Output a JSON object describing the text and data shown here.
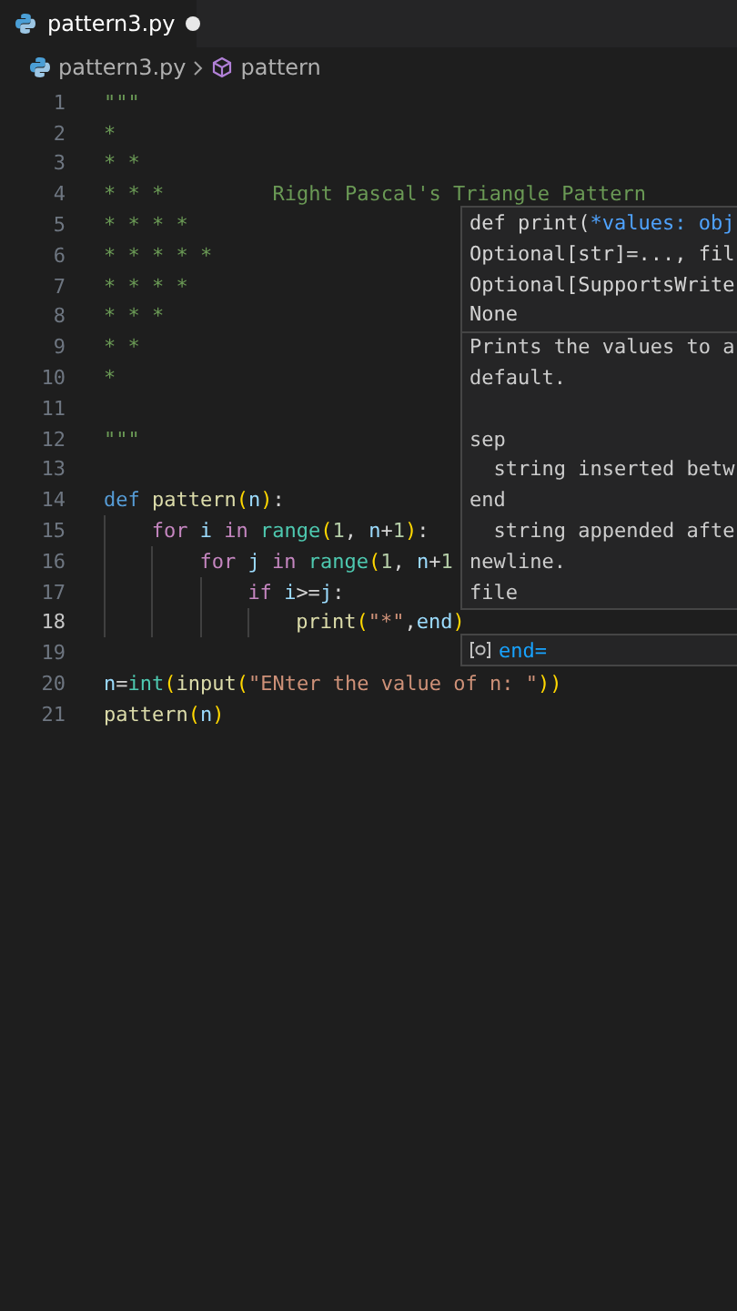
{
  "tab": {
    "title": "pattern3.py",
    "modified": true
  },
  "breadcrumb": {
    "file": "pattern3.py",
    "symbol": "pattern"
  },
  "lines": [
    {
      "number": "1",
      "current": false,
      "tokens": [
        {
          "kind": "doc",
          "text": "\"\"\""
        }
      ]
    },
    {
      "number": "2",
      "current": false,
      "tokens": [
        {
          "kind": "doc",
          "text": "*"
        }
      ]
    },
    {
      "number": "3",
      "current": false,
      "tokens": [
        {
          "kind": "doc",
          "text": "* *"
        }
      ]
    },
    {
      "number": "4",
      "current": false,
      "tokens": [
        {
          "kind": "doc",
          "text": "* * *         Right Pascal's Triangle Pattern"
        }
      ]
    },
    {
      "number": "5",
      "current": false,
      "tokens": [
        {
          "kind": "doc",
          "text": "* * * *"
        }
      ]
    },
    {
      "number": "6",
      "current": false,
      "tokens": [
        {
          "kind": "doc",
          "text": "* * * * *"
        }
      ]
    },
    {
      "number": "7",
      "current": false,
      "tokens": [
        {
          "kind": "doc",
          "text": "* * * *"
        }
      ]
    },
    {
      "number": "8",
      "current": false,
      "tokens": [
        {
          "kind": "doc",
          "text": "* * *"
        }
      ]
    },
    {
      "number": "9",
      "current": false,
      "tokens": [
        {
          "kind": "doc",
          "text": "* *"
        }
      ]
    },
    {
      "number": "10",
      "current": false,
      "tokens": [
        {
          "kind": "doc",
          "text": "*"
        }
      ]
    },
    {
      "number": "11",
      "current": false
    },
    {
      "number": "12",
      "current": false,
      "tokens": [
        {
          "kind": "doc",
          "text": "\"\"\""
        }
      ]
    },
    {
      "number": "13",
      "current": false
    },
    {
      "number": "14",
      "current": false,
      "tokens": [
        {
          "kind": "def",
          "text": "def "
        },
        {
          "kind": "fn",
          "text": "pattern"
        },
        {
          "kind": "bracket",
          "text": "("
        },
        {
          "kind": "var",
          "text": "n"
        },
        {
          "kind": "bracket",
          "text": ")"
        },
        {
          "kind": "punc",
          "text": ":"
        }
      ],
      "children": [
        {
          "number": "15",
          "current": false,
          "tokens": [
            {
              "kind": "kw",
              "text": "for "
            },
            {
              "kind": "var",
              "text": "i "
            },
            {
              "kind": "kw",
              "text": "in "
            },
            {
              "kind": "cls",
              "text": "range"
            },
            {
              "kind": "bracket",
              "text": "("
            },
            {
              "kind": "num",
              "text": "1"
            },
            {
              "kind": "punc",
              "text": ", "
            },
            {
              "kind": "var",
              "text": "n"
            },
            {
              "kind": "punc",
              "text": "+"
            },
            {
              "kind": "num",
              "text": "1"
            },
            {
              "kind": "bracket",
              "text": ")"
            },
            {
              "kind": "punc",
              "text": ":"
            }
          ],
          "children": [
            {
              "number": "16",
              "current": false,
              "tokens": [
                {
                  "kind": "kw",
                  "text": "for "
                },
                {
                  "kind": "var",
                  "text": "j "
                },
                {
                  "kind": "kw",
                  "text": "in "
                },
                {
                  "kind": "cls",
                  "text": "range"
                },
                {
                  "kind": "bracket",
                  "text": "("
                },
                {
                  "kind": "num",
                  "text": "1"
                },
                {
                  "kind": "punc",
                  "text": ", "
                },
                {
                  "kind": "var",
                  "text": "n"
                },
                {
                  "kind": "punc",
                  "text": "+"
                },
                {
                  "kind": "num",
                  "text": "1"
                }
              ],
              "children": [
                {
                  "number": "17",
                  "current": false,
                  "tokens": [
                    {
                      "kind": "kw",
                      "text": "if "
                    },
                    {
                      "kind": "var",
                      "text": "i"
                    },
                    {
                      "kind": "punc",
                      "text": ">="
                    },
                    {
                      "kind": "var",
                      "text": "j"
                    },
                    {
                      "kind": "punc",
                      "text": ":"
                    }
                  ],
                  "children": [
                    {
                      "number": "18",
                      "current": true,
                      "tokens": [
                        {
                          "kind": "fn",
                          "text": "print"
                        },
                        {
                          "kind": "bracket",
                          "text": "("
                        },
                        {
                          "kind": "str",
                          "text": "\"*\""
                        },
                        {
                          "kind": "punc",
                          "text": ","
                        },
                        {
                          "kind": "var",
                          "text": "end"
                        },
                        {
                          "kind": "bracket",
                          "text": ")"
                        }
                      ]
                    }
                  ]
                }
              ]
            }
          ]
        }
      ]
    },
    {
      "number": "19",
      "current": false
    },
    {
      "number": "20",
      "current": false,
      "tokens": [
        {
          "kind": "var",
          "text": "n"
        },
        {
          "kind": "punc",
          "text": "="
        },
        {
          "kind": "cls",
          "text": "int"
        },
        {
          "kind": "bracket",
          "text": "("
        },
        {
          "kind": "fn",
          "text": "input"
        },
        {
          "kind": "bracket",
          "text": "("
        },
        {
          "kind": "str",
          "text": "\"ENter the value of n: \""
        },
        {
          "kind": "bracket",
          "text": "))"
        }
      ]
    },
    {
      "number": "21",
      "current": false,
      "tokens": [
        {
          "kind": "fn",
          "text": "pattern"
        },
        {
          "kind": "bracket",
          "text": "("
        },
        {
          "kind": "var",
          "text": "n"
        },
        {
          "kind": "bracket",
          "text": ")"
        }
      ]
    }
  ],
  "hover": {
    "signature": [
      [
        {
          "kind": "punc",
          "text": "def print("
        },
        {
          "kind": "param",
          "text": "*values: obj"
        }
      ],
      [
        {
          "kind": "punc",
          "text": "Optional[str]=..., fil"
        }
      ],
      [
        {
          "kind": "punc",
          "text": "Optional[SupportsWrite"
        }
      ],
      [
        {
          "kind": "punc",
          "text": "None"
        }
      ]
    ],
    "docs": [
      [
        "Prints the values to a",
        "default."
      ],
      [
        "sep",
        "  string inserted betw",
        "end",
        "  string appended afte",
        "newline.",
        "file"
      ]
    ]
  },
  "suggestion": {
    "label": "end="
  }
}
